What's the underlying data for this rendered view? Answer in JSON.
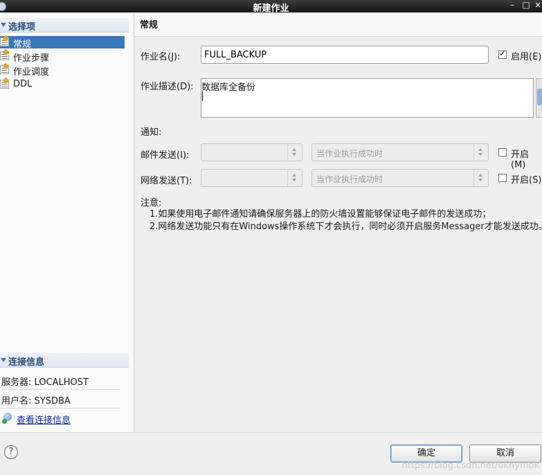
{
  "window": {
    "title": "新建作业",
    "controls": [
      "–",
      "□",
      "×"
    ]
  },
  "sidebar": {
    "section_title": "选择项",
    "items": [
      {
        "label": "常规",
        "selected": true,
        "icon": "properties-icon"
      },
      {
        "label": "作业步骤",
        "selected": false,
        "icon": "properties-icon"
      },
      {
        "label": "作业调度",
        "selected": false,
        "icon": "properties-icon"
      },
      {
        "label": "DDL",
        "selected": false,
        "icon": "properties-icon"
      }
    ],
    "connection": {
      "section_title": "连接信息",
      "server": "服务器: LOCALHOST",
      "user": "用户名: SYSDBA",
      "link": "查看连接信息"
    }
  },
  "main": {
    "page_title": "常规",
    "job_name_label": "作业名(J):",
    "job_name_value": "FULL_BACKUP",
    "enable_label": "启用(E)",
    "enable_checked": true,
    "desc_label": "作业描述(D):",
    "desc_value": "数据库全备份",
    "notify_label": "通知:",
    "mail_label": "邮件发送(I):",
    "mail_condition": "当作业执行成功时",
    "mail_open_label": "开启(M)",
    "net_label": "网络发送(T):",
    "net_condition": "当作业执行成功时",
    "net_open_label": "开启(S)",
    "note_title": "注意:",
    "note_1": "1.如果使用电子邮件通知请确保服务器上的防火墙设置能够保证电子邮件的发送成功；",
    "note_2": "2.网络发送功能只有在Windows操作系统下才会执行，同时必须开启服务Messager才能发送成功。"
  },
  "footer": {
    "help": "?",
    "ok": "确定",
    "cancel": "取消",
    "watermark": "https://blog.csdn.net/okhymok"
  }
}
